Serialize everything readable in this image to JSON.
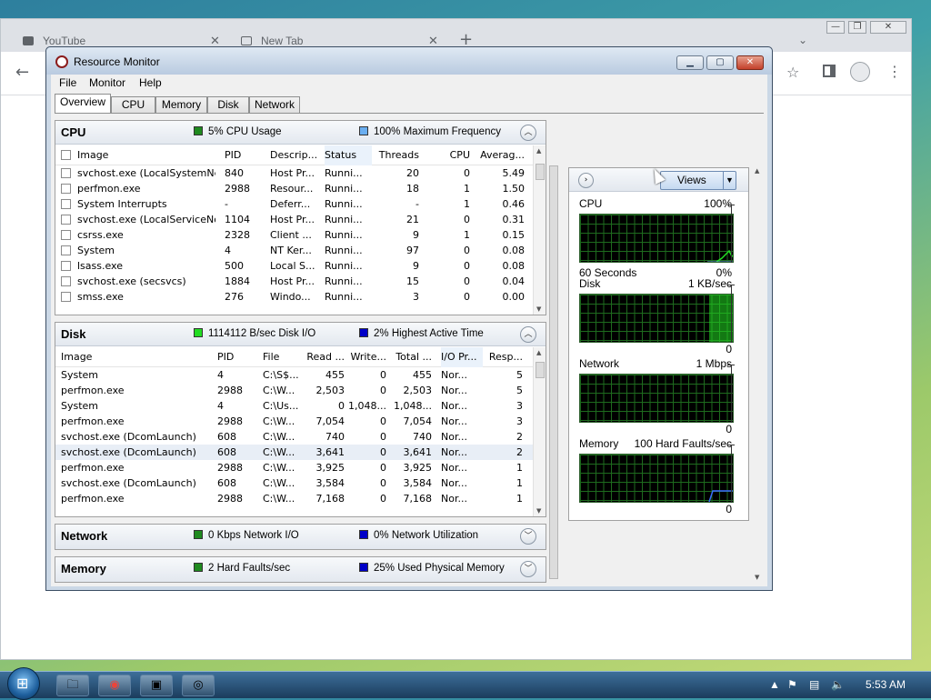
{
  "browser": {
    "tabs": [
      {
        "label": "YouTube"
      },
      {
        "label": "New Tab"
      }
    ],
    "controls": {
      "minimize": "—",
      "restore": "❐",
      "close": "✕"
    }
  },
  "window": {
    "title": "Resource Monitor",
    "menu": [
      "File",
      "Monitor",
      "Help"
    ],
    "tabs": [
      "Overview",
      "CPU",
      "Memory",
      "Disk",
      "Network"
    ],
    "active_tab": "Overview"
  },
  "cpu": {
    "title": "CPU",
    "legend1": "5% CPU Usage",
    "legend1_color": "#1f8a1f",
    "legend2": "100% Maximum Frequency",
    "legend2_color": "#6aaef0",
    "columns": [
      "Image",
      "PID",
      "Descrip...",
      "Status",
      "Threads",
      "CPU",
      "Averag..."
    ],
    "rows": [
      [
        "svchost.exe (LocalSystemNet...",
        "840",
        "Host Pr...",
        "Runni...",
        "20",
        "0",
        "5.49"
      ],
      [
        "perfmon.exe",
        "2988",
        "Resour...",
        "Runni...",
        "18",
        "1",
        "1.50"
      ],
      [
        "System Interrupts",
        "-",
        "Deferr...",
        "Runni...",
        "-",
        "1",
        "0.46"
      ],
      [
        "svchost.exe (LocalServiceNo...",
        "1104",
        "Host Pr...",
        "Runni...",
        "21",
        "0",
        "0.31"
      ],
      [
        "csrss.exe",
        "2328",
        "Client ...",
        "Runni...",
        "9",
        "1",
        "0.15"
      ],
      [
        "System",
        "4",
        "NT Ker...",
        "Runni...",
        "97",
        "0",
        "0.08"
      ],
      [
        "lsass.exe",
        "500",
        "Local S...",
        "Runni...",
        "9",
        "0",
        "0.08"
      ],
      [
        "svchost.exe (secsvcs)",
        "1884",
        "Host Pr...",
        "Runni...",
        "15",
        "0",
        "0.04"
      ],
      [
        "smss.exe",
        "276",
        "Windo...",
        "Runni...",
        "3",
        "0",
        "0.00"
      ]
    ]
  },
  "disk": {
    "title": "Disk",
    "legend1": "1114112 B/sec Disk I/O",
    "legend1_color": "#22dd22",
    "legend2": "2% Highest Active Time",
    "legend2_color": "#0000c8",
    "columns": [
      "Image",
      "PID",
      "File",
      "Read ...",
      "Write...",
      "Total ...",
      "I/O Pr...",
      "Resp..."
    ],
    "rows": [
      [
        "System",
        "4",
        "C:\\S$...",
        "455",
        "0",
        "455",
        "Nor...",
        "5"
      ],
      [
        "perfmon.exe",
        "2988",
        "C:\\W...",
        "2,503",
        "0",
        "2,503",
        "Nor...",
        "5"
      ],
      [
        "System",
        "4",
        "C:\\Us...",
        "0",
        "1,048...",
        "1,048...",
        "Nor...",
        "3"
      ],
      [
        "perfmon.exe",
        "2988",
        "C:\\W...",
        "7,054",
        "0",
        "7,054",
        "Nor...",
        "3"
      ],
      [
        "svchost.exe (DcomLaunch)",
        "608",
        "C:\\W...",
        "740",
        "0",
        "740",
        "Nor...",
        "2"
      ],
      [
        "svchost.exe (DcomLaunch)",
        "608",
        "C:\\W...",
        "3,641",
        "0",
        "3,641",
        "Nor...",
        "2"
      ],
      [
        "perfmon.exe",
        "2988",
        "C:\\W...",
        "3,925",
        "0",
        "3,925",
        "Nor...",
        "1"
      ],
      [
        "svchost.exe (DcomLaunch)",
        "608",
        "C:\\W...",
        "3,584",
        "0",
        "3,584",
        "Nor...",
        "1"
      ],
      [
        "perfmon.exe",
        "2988",
        "C:\\W...",
        "7,168",
        "0",
        "7,168",
        "Nor...",
        "1"
      ]
    ]
  },
  "network": {
    "title": "Network",
    "legend1": "0 Kbps Network I/O",
    "legend1_color": "#1f8a1f",
    "legend2": "0% Network Utilization",
    "legend2_color": "#0000c8"
  },
  "memory": {
    "title": "Memory",
    "legend1": "2 Hard Faults/sec",
    "legend1_color": "#1f8a1f",
    "legend2": "25% Used Physical Memory",
    "legend2_color": "#0000c8"
  },
  "sidepanel": {
    "views_label": "Views",
    "graphs": [
      {
        "title": "CPU",
        "scale": "100%",
        "foot_left": "60 Seconds",
        "foot_right": "0%"
      },
      {
        "title": "Disk",
        "scale": "1 KB/sec",
        "foot_left": "",
        "foot_right": "0"
      },
      {
        "title": "Network",
        "scale": "1 Mbps",
        "foot_left": "",
        "foot_right": "0"
      },
      {
        "title": "Memory",
        "scale": "100 Hard Faults/sec",
        "foot_left": "",
        "foot_right": "0"
      }
    ]
  },
  "taskbar": {
    "clock": "5:53 AM"
  }
}
